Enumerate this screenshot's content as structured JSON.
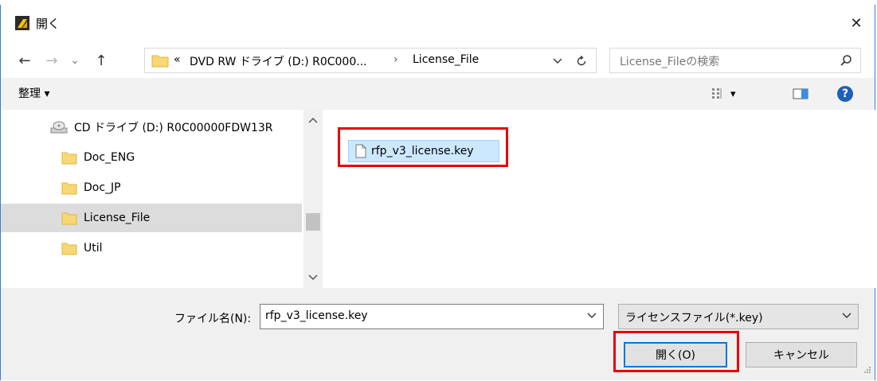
{
  "dialog": {
    "title": "開く",
    "close_glyph": "✕"
  },
  "nav": {
    "back_glyph": "←",
    "forward_glyph": "→",
    "recent_glyph": "⌄",
    "up_glyph": "↑",
    "address": {
      "overflow": "«",
      "segment_1": "DVD RW ドライブ (D:) R0C000...",
      "separator": "›",
      "segment_2": "License_File"
    },
    "search_placeholder": "License_Fileの検索"
  },
  "toolbar": {
    "organize_label": "整理 ▾",
    "view_dd_glyph": "▾",
    "help_glyph": "?"
  },
  "tree": {
    "items": [
      {
        "label": "CD ドライブ (D:) R0C00000FDW13R",
        "icon": "cd-drive-icon"
      },
      {
        "label": "Doc_ENG",
        "icon": "folder-icon"
      },
      {
        "label": "Doc_JP",
        "icon": "folder-icon"
      },
      {
        "label": "License_File",
        "icon": "folder-icon",
        "selected": true
      },
      {
        "label": "Util",
        "icon": "folder-icon"
      }
    ]
  },
  "files": {
    "items": [
      {
        "label": "rfp_v3_license.key",
        "icon": "file-icon",
        "selected": true
      }
    ]
  },
  "bottom": {
    "filename_label": "ファイル名(N):",
    "filename_value": "rfp_v3_license.key",
    "filetype_value": "ライセンスファイル(*.key)",
    "open_label": "開く(O)",
    "cancel_label": "キャンセル"
  },
  "colors": {
    "highlight_box": "#e8000b",
    "selection": "#cce8ff",
    "window_border": "#3b7ad9",
    "help_blue": "#1e5fb8"
  }
}
